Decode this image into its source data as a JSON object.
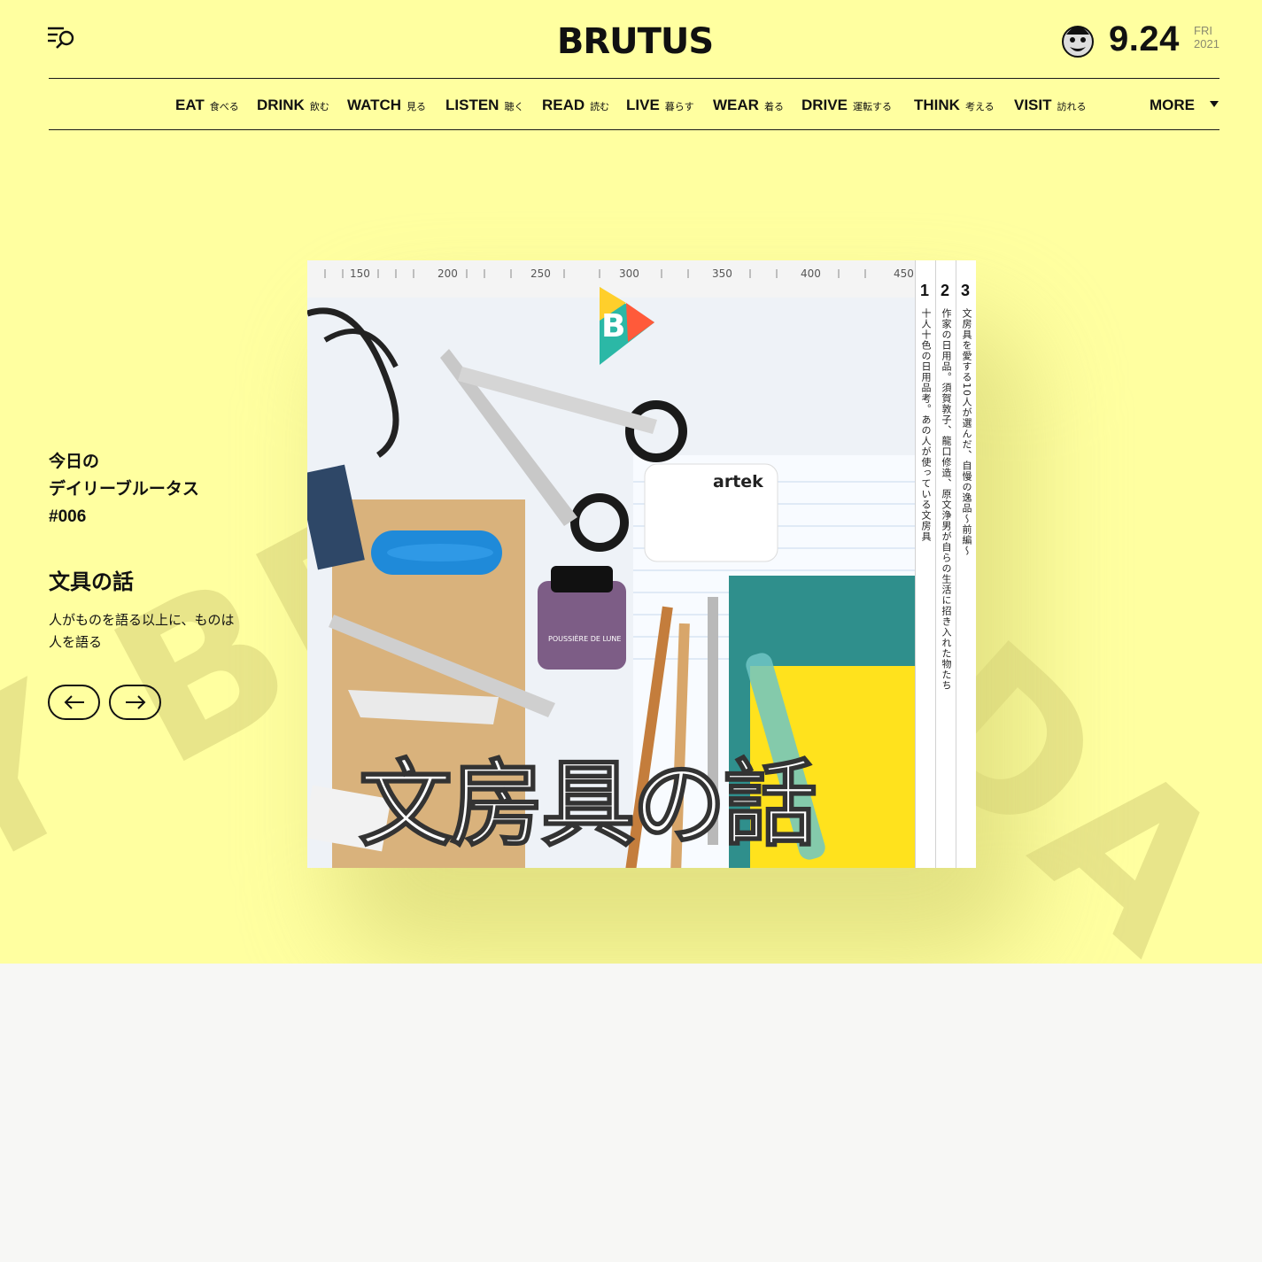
{
  "header": {
    "logo_text": "BRUTUS",
    "date": "9.24",
    "weekday": "FRI",
    "year": "2021",
    "menu_icon": "menu-search-icon",
    "mascot_icon": "mascot-icon"
  },
  "nav": {
    "items": [
      {
        "en": "EAT",
        "jp": "食べる"
      },
      {
        "en": "DRINK",
        "jp": "飲む"
      },
      {
        "en": "WATCH",
        "jp": "見る"
      },
      {
        "en": "LISTEN",
        "jp": "聴く"
      },
      {
        "en": "READ",
        "jp": "読む"
      },
      {
        "en": "LIVE",
        "jp": "暮らす"
      },
      {
        "en": "WEAR",
        "jp": "着る"
      },
      {
        "en": "DRIVE",
        "jp": "運転する"
      },
      {
        "en": "THINK",
        "jp": "考える"
      },
      {
        "en": "VISIT",
        "jp": "訪れる"
      }
    ],
    "more_label": "MORE"
  },
  "feature": {
    "issue_line1": "今日の",
    "issue_line2": "デイリーブルータス",
    "issue_number": "#006",
    "title": "文具の話",
    "desc_line1": "人がものを語る以上に、ものは",
    "desc_line2": "人を語る"
  },
  "cover": {
    "title": "文房具の話",
    "brand_label": "artek",
    "ink_label": "POUSSIÈRE DE LUNE",
    "ruler_marks": [
      "150",
      "200",
      "250",
      "300",
      "350",
      "400",
      "450"
    ],
    "spines": [
      {
        "num": "1",
        "text": "十人十色の日用品考。あの人が使っている文房具"
      },
      {
        "num": "2",
        "text": "作家の日用品。須賀敦子、龍口修造、原文浄男が自らの生活に招き入れた物たち"
      },
      {
        "num": "3",
        "text": "文房具を愛する10人が選んだ、自慢の逸品～前編～"
      }
    ]
  },
  "background_text": {
    "left": "Y BR",
    "right": "DA"
  },
  "colors": {
    "hero_bg": "#ffffa0",
    "page_bg": "#f7f7f5",
    "text": "#111111"
  }
}
